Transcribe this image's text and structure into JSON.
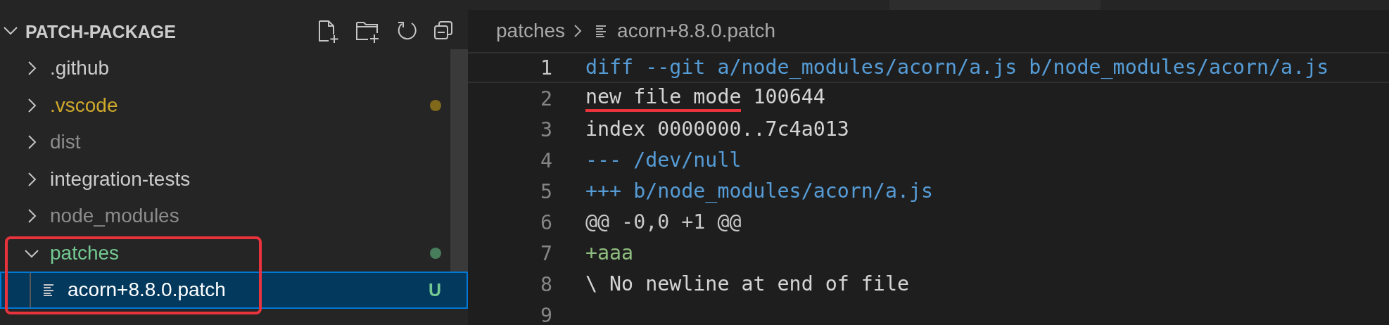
{
  "explorer": {
    "title": "PATCH-PACKAGE",
    "expanded": true,
    "items": [
      {
        "kind": "folder",
        "name": ".github",
        "expanded": false,
        "color": "#cccccc",
        "dot": false,
        "selected": false,
        "annotated": false
      },
      {
        "kind": "folder",
        "name": ".vscode",
        "expanded": false,
        "color": "#d0a92b",
        "dot": true,
        "selected": false,
        "annotated": false
      },
      {
        "kind": "folder",
        "name": "dist",
        "expanded": false,
        "color": "#8c8c8c",
        "dot": false,
        "selected": false,
        "annotated": false
      },
      {
        "kind": "folder",
        "name": "integration-tests",
        "expanded": false,
        "color": "#cccccc",
        "dot": false,
        "selected": false,
        "annotated": false
      },
      {
        "kind": "folder",
        "name": "node_modules",
        "expanded": false,
        "color": "#8c8c8c",
        "dot": false,
        "selected": false,
        "annotated": false
      },
      {
        "kind": "folder",
        "name": "patches",
        "expanded": true,
        "color": "#73c991",
        "dot": true,
        "selected": false,
        "annotated": true,
        "children": [
          {
            "kind": "file",
            "name": "acorn+8.8.0.patch",
            "badge": "U",
            "selected": true,
            "annotated": false
          }
        ]
      }
    ]
  },
  "editor": {
    "breadcrumb": [
      "patches",
      "acorn+8.8.0.patch"
    ],
    "lines": [
      {
        "number": "1",
        "kind": "header",
        "current": true,
        "parts": [
          {
            "text": "diff --git a/node_modules/acorn/a.js b/node_modules/acorn/a.js",
            "underlined": false
          }
        ]
      },
      {
        "number": "2",
        "kind": "plain",
        "current": false,
        "parts": [
          {
            "text": "new file mode",
            "underlined": true
          },
          {
            "text": " 100644",
            "underlined": false
          }
        ]
      },
      {
        "number": "3",
        "kind": "plain",
        "current": false,
        "parts": [
          {
            "text": "index 0000000..7c4a013",
            "underlined": false
          }
        ]
      },
      {
        "number": "4",
        "kind": "header",
        "current": false,
        "parts": [
          {
            "text": "--- /dev/null",
            "underlined": false
          }
        ]
      },
      {
        "number": "5",
        "kind": "header",
        "current": false,
        "parts": [
          {
            "text": "+++ b/node_modules/acorn/a.js",
            "underlined": false
          }
        ]
      },
      {
        "number": "6",
        "kind": "hunk",
        "current": false,
        "parts": [
          {
            "text": "@@ -0,0 +1 @@",
            "underlined": false
          }
        ]
      },
      {
        "number": "7",
        "kind": "added",
        "current": false,
        "parts": [
          {
            "text": "+aaa",
            "underlined": false
          }
        ]
      },
      {
        "number": "8",
        "kind": "plain",
        "current": false,
        "parts": [
          {
            "text": "\\ No newline at end of file",
            "underlined": false
          }
        ]
      },
      {
        "number": "9",
        "current": false
      }
    ]
  }
}
